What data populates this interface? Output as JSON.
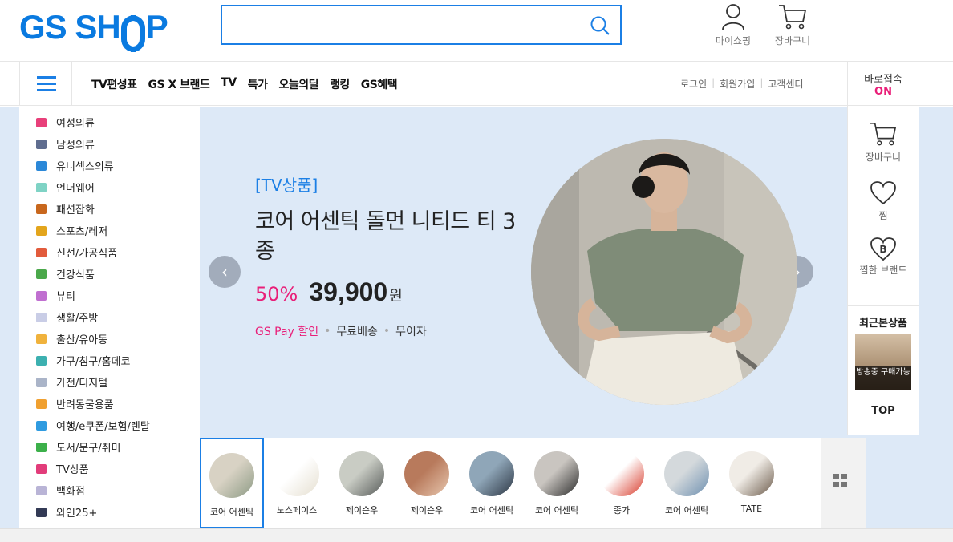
{
  "header": {
    "logo": "GS SHOP",
    "search_placeholder": "",
    "mypage_label": "마이쇼핑",
    "cart_label": "장바구니"
  },
  "nav": {
    "menu": [
      "TV편성표",
      "GS X 브랜드",
      "TV",
      "특가",
      "오늘의딜",
      "랭킹",
      "GS혜택"
    ],
    "login": "로그인",
    "signup": "회원가입",
    "support": "고객센터",
    "quick_label": "바로접속",
    "quick_status": "ON"
  },
  "categories": [
    {
      "label": "여성의류",
      "color": "#e8407a"
    },
    {
      "label": "남성의류",
      "color": "#5f6d8f"
    },
    {
      "label": "유니섹스의류",
      "color": "#2b88d8"
    },
    {
      "label": "언더웨어",
      "color": "#7fd3c5"
    },
    {
      "label": "패션잡화",
      "color": "#c8671d"
    },
    {
      "label": "스포츠/레저",
      "color": "#e3a51c"
    },
    {
      "label": "신선/가공식품",
      "color": "#e25b3c"
    },
    {
      "label": "건강식품",
      "color": "#4aa84a"
    },
    {
      "label": "뷰티",
      "color": "#c06fd0"
    },
    {
      "label": "생활/주방",
      "color": "#c9cde6"
    },
    {
      "label": "출산/유아동",
      "color": "#f0b23c"
    },
    {
      "label": "가구/침구/홈데코",
      "color": "#3cb0b0"
    },
    {
      "label": "가전/디지털",
      "color": "#aab4c8"
    },
    {
      "label": "반려동물용품",
      "color": "#f0a030"
    },
    {
      "label": "여행/e쿠폰/보험/렌탈",
      "color": "#2f9be0"
    },
    {
      "label": "도서/문구/취미",
      "color": "#3cb04a"
    },
    {
      "label": "TV상품",
      "color": "#e23c7a"
    },
    {
      "label": "백화점",
      "color": "#b9b4d6"
    },
    {
      "label": "와인25+",
      "color": "#333a55"
    }
  ],
  "hero": {
    "tag": "[TV상품]",
    "title": "코어 어센틱 돌먼 니티드 티 3종",
    "discount": "50%",
    "price": "39,900",
    "currency": "원",
    "benefit1": "GS Pay 할인",
    "benefit2": "무료배송",
    "benefit3": "무이자"
  },
  "thumbs": [
    {
      "label": "코어 어센틱",
      "colors": [
        "#d8d2c4",
        "#8c9a84"
      ]
    },
    {
      "label": "노스페이스",
      "colors": [
        "#ffffff",
        "#e5dfd0"
      ]
    },
    {
      "label": "제이슨우",
      "colors": [
        "#c9ccc4",
        "#565a58"
      ]
    },
    {
      "label": "제이슨우",
      "colors": [
        "#b87a5c",
        "#e8c8b0"
      ]
    },
    {
      "label": "코어 어센틱",
      "colors": [
        "#8fa6b8",
        "#2b3542"
      ]
    },
    {
      "label": "코어 어센틱",
      "colors": [
        "#c9c5c0",
        "#2a2a2a"
      ]
    },
    {
      "label": "종가",
      "colors": [
        "#ffffff",
        "#d83a2a"
      ]
    },
    {
      "label": "코어 어센틱",
      "colors": [
        "#d4d9dc",
        "#6d8fb0"
      ]
    },
    {
      "label": "TATE",
      "colors": [
        "#f0ece6",
        "#6b5a4a"
      ]
    }
  ],
  "rail": {
    "cart": "장바구니",
    "wish": "찜",
    "brand_wish": "찜한 브랜드",
    "recent_title": "최근본상품",
    "recent_badge": "방송중 구매가능",
    "top": "TOP"
  }
}
